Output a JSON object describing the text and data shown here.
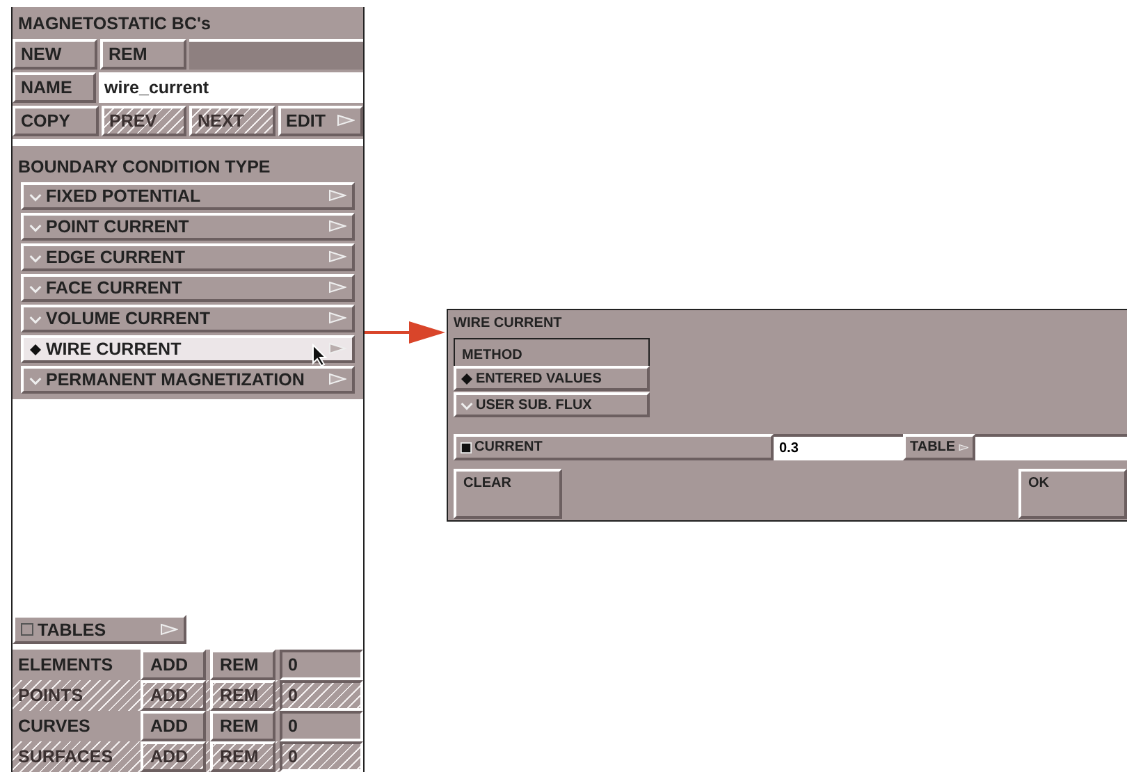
{
  "bc_panel": {
    "title": "MAGNETOSTATIC BC's",
    "top_buttons": [
      {
        "label": "NEW"
      },
      {
        "label": "REM"
      }
    ],
    "name_button": "NAME",
    "name_value": "wire_current",
    "nav_buttons": [
      {
        "label": "COPY",
        "disabled": false,
        "menu": false
      },
      {
        "label": "PREV",
        "disabled": true,
        "menu": false
      },
      {
        "label": "NEXT",
        "disabled": true,
        "menu": false
      },
      {
        "label": "EDIT",
        "disabled": false,
        "menu": true
      }
    ],
    "section_title": "BOUNDARY CONDITION TYPE",
    "types": [
      {
        "label": "FIXED POTENTIAL",
        "selected": false
      },
      {
        "label": "POINT CURRENT",
        "selected": false
      },
      {
        "label": "EDGE CURRENT",
        "selected": false
      },
      {
        "label": "FACE CURRENT",
        "selected": false
      },
      {
        "label": "VOLUME CURRENT",
        "selected": false
      },
      {
        "label": "WIRE CURRENT",
        "selected": true
      },
      {
        "label": "PERMANENT MAGNETIZATION",
        "selected": false
      }
    ],
    "tables": {
      "label": "TABLES",
      "checked": false
    },
    "entities": [
      {
        "label": "ELEMENTS",
        "add": "ADD",
        "rem": "REM",
        "count": "0",
        "disabled": false
      },
      {
        "label": "POINTS",
        "add": "ADD",
        "rem": "REM",
        "count": "0",
        "disabled": true
      },
      {
        "label": "CURVES",
        "add": "ADD",
        "rem": "REM",
        "count": "0",
        "disabled": false
      },
      {
        "label": "SURFACES",
        "add": "ADD",
        "rem": "REM",
        "count": "0",
        "disabled": true
      }
    ]
  },
  "dialog": {
    "title": "WIRE CURRENT",
    "method_label": "METHOD",
    "methods": [
      {
        "label": "ENTERED VALUES",
        "selected": true
      },
      {
        "label": "USER SUB. FLUX",
        "selected": false
      }
    ],
    "current": {
      "label": "CURRENT",
      "checked": true,
      "value": "0.3",
      "table_button": "TABLE"
    },
    "buttons": [
      {
        "label": "CLEAR"
      },
      {
        "label": "OK"
      }
    ]
  }
}
